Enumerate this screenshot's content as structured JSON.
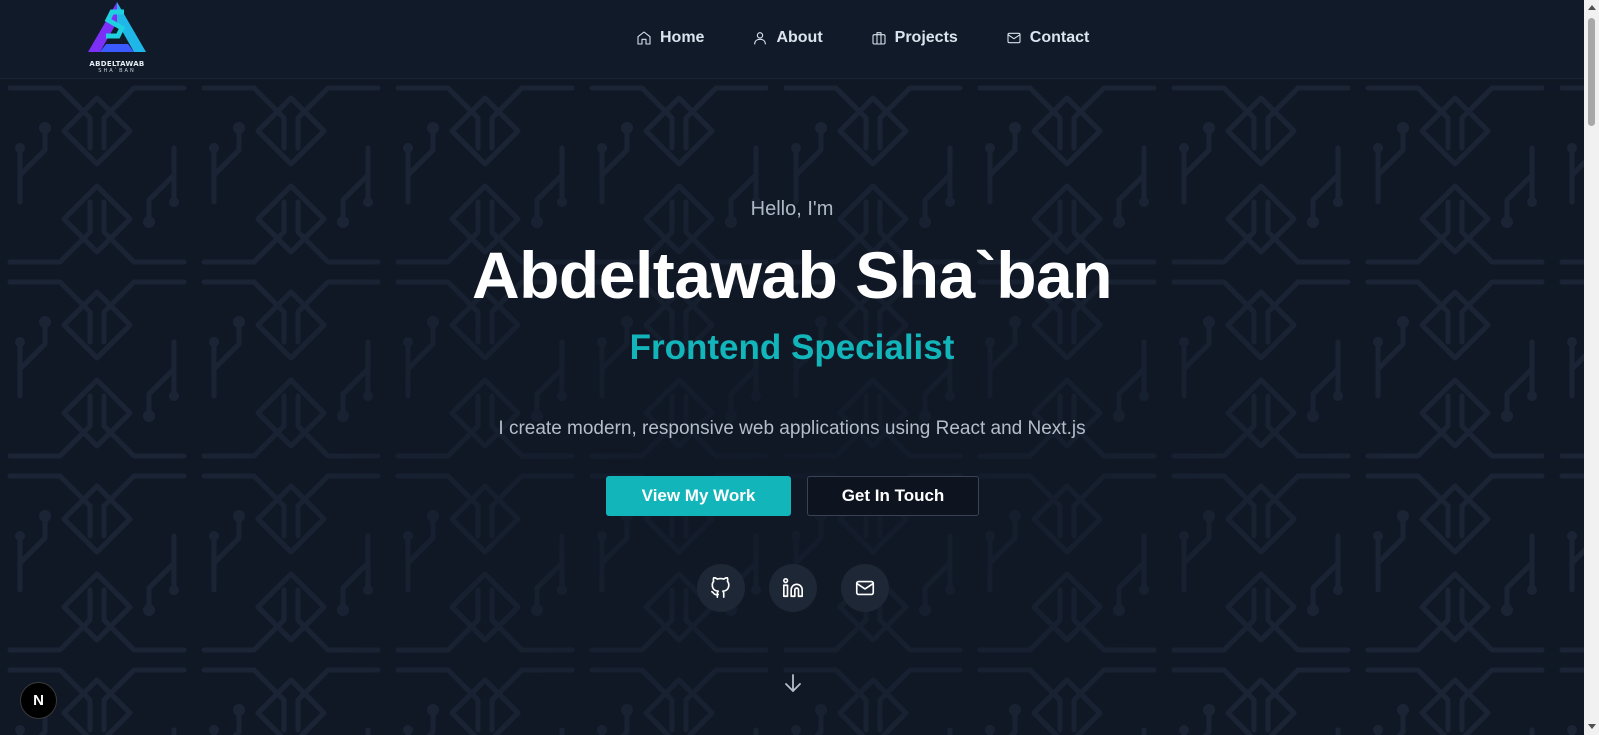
{
  "logo": {
    "name": "ABDELTAWAB",
    "sub": "SHA`BAN",
    "icon": "brand-logo-icon"
  },
  "nav": {
    "items": [
      {
        "label": "Home",
        "icon": "home-icon"
      },
      {
        "label": "About",
        "icon": "user-icon"
      },
      {
        "label": "Projects",
        "icon": "briefcase-icon"
      },
      {
        "label": "Contact",
        "icon": "mail-icon"
      }
    ]
  },
  "hero": {
    "greeting": "Hello, I'm",
    "name": "Abdeltawab Sha`ban",
    "role": "Frontend Specialist",
    "description": "I create modern, responsive web applications using React and Next.js",
    "primary_button": "View My Work",
    "secondary_button": "Get In Touch"
  },
  "social": [
    {
      "icon": "github-icon"
    },
    {
      "icon": "linkedin-icon"
    },
    {
      "icon": "mail-icon"
    }
  ],
  "next_badge": "N",
  "colors": {
    "accent": "#12b5b9",
    "background": "#101826",
    "header": "#111a29"
  }
}
